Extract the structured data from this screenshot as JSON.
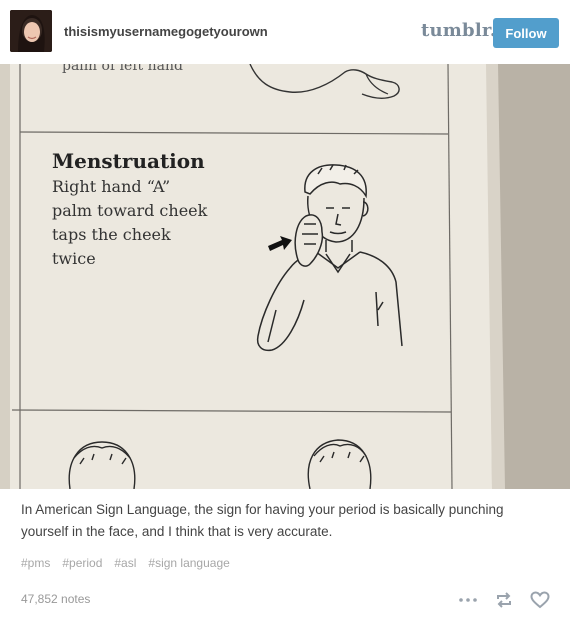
{
  "header": {
    "username": "thisismyusernamegogetyourown",
    "brand": "tumblr.",
    "follow_label": "Follow"
  },
  "photo": {
    "top_partial_text": "palm of left hand",
    "title": "Menstruation",
    "lines": [
      "Right hand “A”",
      "palm toward cheek",
      "taps the cheek",
      "twice"
    ]
  },
  "caption": "In American Sign Language, the sign for having your period is basically punching yourself in the face, and I think that is very accurate.",
  "tags": [
    "#pms",
    "#period",
    "#asl",
    "#sign language"
  ],
  "notes": "47,852 notes",
  "icons": {
    "more": "more-icon",
    "reblog": "reblog-icon",
    "like": "heart-icon"
  },
  "colors": {
    "follow": "#529ecc",
    "brand": "#7a8a99",
    "tag": "#a7a7a7"
  }
}
